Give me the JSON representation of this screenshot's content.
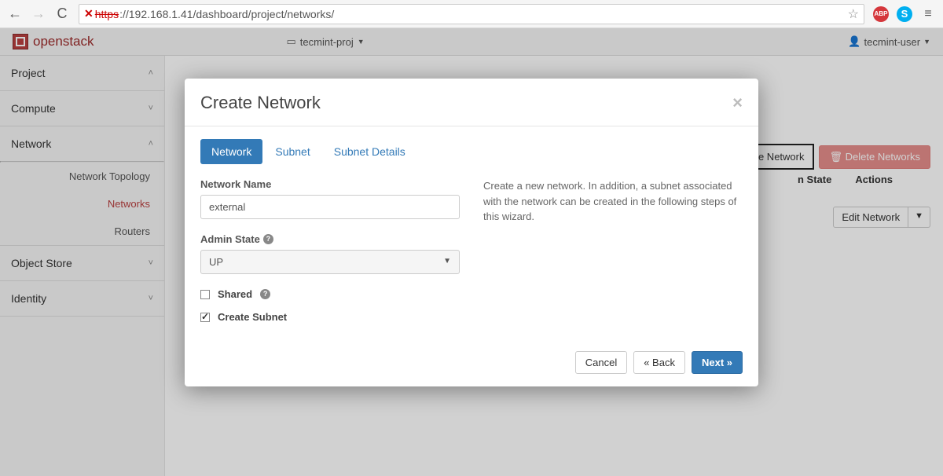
{
  "browser": {
    "url_protocol": "https",
    "url_rest": "://192.168.1.41/dashboard/project/networks/",
    "extensions": {
      "abp": "ABP",
      "skype": "S"
    }
  },
  "topbar": {
    "logo_text": "openstack",
    "project": "tecmint-proj",
    "user": "tecmint-user"
  },
  "sidebar": {
    "project": "Project",
    "compute": "Compute",
    "network": "Network",
    "network_topology": "Network Topology",
    "networks": "Networks",
    "routers": "Routers",
    "object_store": "Object Store",
    "identity": "Identity"
  },
  "page_actions": {
    "create": "Create Network",
    "delete": "Delete Networks",
    "col_state": "n State",
    "col_actions": "Actions",
    "edit": "Edit Network"
  },
  "modal": {
    "title": "Create Network",
    "tabs": {
      "network": "Network",
      "subnet": "Subnet",
      "details": "Subnet Details"
    },
    "network_name_label": "Network Name",
    "network_name_value": "external",
    "admin_state_label": "Admin State",
    "admin_state_value": "UP",
    "shared_label": "Shared",
    "create_subnet_label": "Create Subnet",
    "help": "Create a new network. In addition, a subnet associated with the network can be created in the following steps of this wizard.",
    "cancel": "Cancel",
    "back": "« Back",
    "next": "Next »"
  }
}
